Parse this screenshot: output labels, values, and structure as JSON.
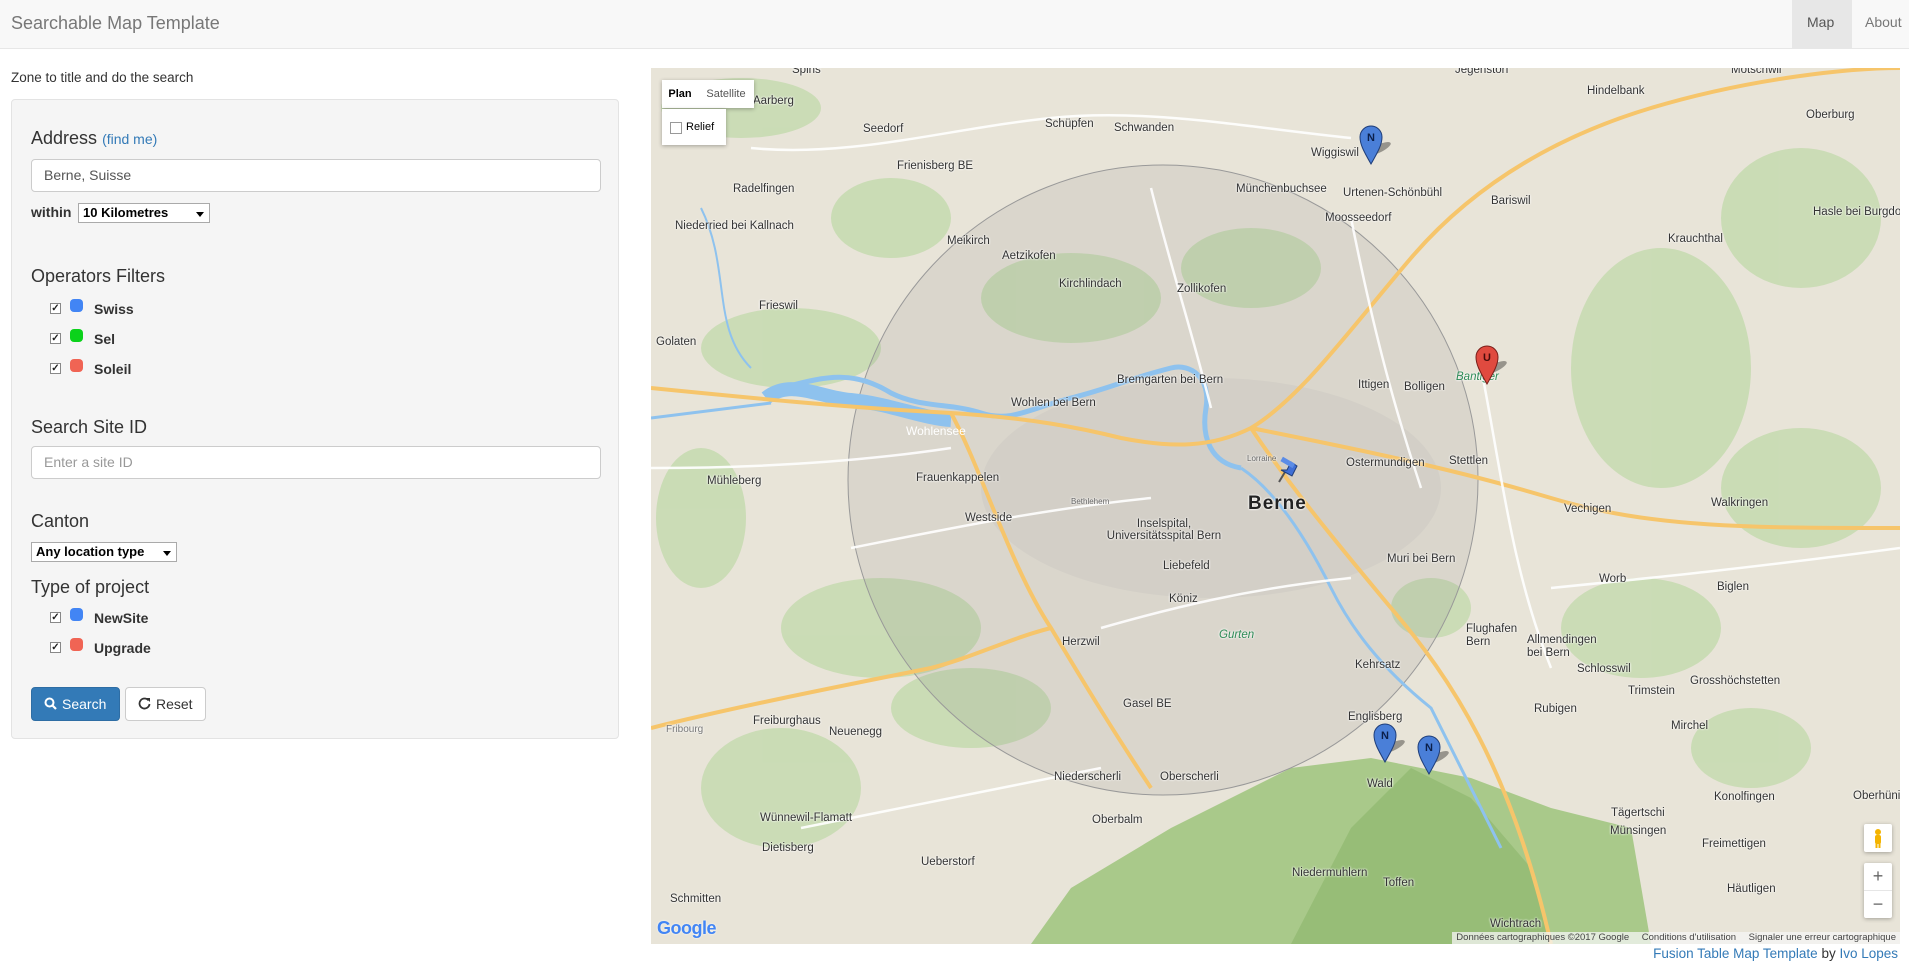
{
  "navbar": {
    "brand": "Searchable Map Template",
    "items": [
      {
        "label": "Map",
        "active": true
      },
      {
        "label": "About",
        "active": false
      }
    ]
  },
  "intro_text": "Zone to title and do the search",
  "address": {
    "heading": "Address",
    "find_me": "(find me)",
    "value": "Berne, Suisse",
    "within_label": "within",
    "radius": "10 Kilometres"
  },
  "operators": {
    "heading": "Operators Filters",
    "items": [
      {
        "label": "Swiss",
        "checked": true,
        "color": "#4285f4"
      },
      {
        "label": "Sel",
        "checked": true,
        "color": "#0bd21b"
      },
      {
        "label": "Soleil",
        "checked": true,
        "color": "#f06454"
      }
    ]
  },
  "site_id": {
    "heading": "Search Site ID",
    "placeholder": "Enter a site ID"
  },
  "canton": {
    "heading": "Canton",
    "selected": "Any location type"
  },
  "project_type": {
    "heading": "Type of project",
    "items": [
      {
        "label": "NewSite",
        "checked": true,
        "color": "#4285f4"
      },
      {
        "label": "Upgrade",
        "checked": true,
        "color": "#f06454"
      }
    ]
  },
  "buttons": {
    "search": "Search",
    "reset": "Reset"
  },
  "map": {
    "type_controls": {
      "plan": "Plan",
      "satellite": "Satellite",
      "relief": "Relief"
    },
    "center_label": "Berne",
    "markers": [
      {
        "letter": "N",
        "color": "#4a7fd8"
      },
      {
        "letter": "U",
        "color": "#e04a3f"
      },
      {
        "letter": "N",
        "color": "#4a7fd8"
      },
      {
        "letter": "N",
        "color": "#4a7fd8"
      }
    ],
    "places": [
      "Spins",
      "Jegenstorf",
      "Motschwil",
      "Aarberg",
      "Hindelbank",
      "Oberburg",
      "Seedorf",
      "Schüpfen",
      "Schwanden",
      "Wiggiswil",
      "Frienisberg BE",
      "Münchenbuchsee",
      "Urtenen-Schönbühl",
      "Bariswil",
      "Radelfingen",
      "Moosseedorf",
      "Hasle bei Burgdorf",
      "Niederried bei Kallnach",
      "Meikirch",
      "Aetzikofen",
      "Krauchthal",
      "Kirchlindach",
      "Zollikofen",
      "Frieswil",
      "Golaten",
      "Bremgarten bei Bern",
      "Ittigen",
      "Bolligen",
      "Bantiger",
      "Wohlen bei Bern",
      "Wohlensee",
      "Mühleberg",
      "Ostermundigen",
      "Stettlen",
      "Frauenkappelen",
      "Westside",
      "Berne",
      "Inselspital, Universitätsspital Bern",
      "Vechigen",
      "Walkringen",
      "Liebefeld",
      "Muri bei Bern",
      "Worb",
      "Biglen",
      "Köniz",
      "Flughafen Bern",
      "Allmendingen bei Bern",
      "Gurten",
      "Herzwil",
      "Kehrsatz",
      "Schlosswil",
      "Grosshöchstetten",
      "Gasel BE",
      "Trimstein",
      "Freiburghaus",
      "Neuenegg",
      "Englisberg",
      "Rubigen",
      "Mirchel",
      "Niederscherli",
      "Oberscherli",
      "Wald",
      "Konolfingen",
      "Wünnewil-Flamatt",
      "Oberbalm",
      "Tägertschi",
      "Münsingen",
      "Freimettigen",
      "Dietisberg",
      "Ueberstorf",
      "Niedermuhlern",
      "Toffen",
      "Häutligen",
      "Schmitten",
      "Wichtrach",
      "Oberhünigen",
      "Lorraine",
      "Bethlehem",
      "Fribourg"
    ],
    "footer_credits": [
      "Données cartographiques ©2017 Google",
      "Conditions d'utilisation",
      "Signaler une erreur cartographique"
    ],
    "google_logo": "Google"
  },
  "footer": {
    "link1": "Fusion Table Map Template",
    "by": " by ",
    "link2": "Ivo Lopes"
  }
}
